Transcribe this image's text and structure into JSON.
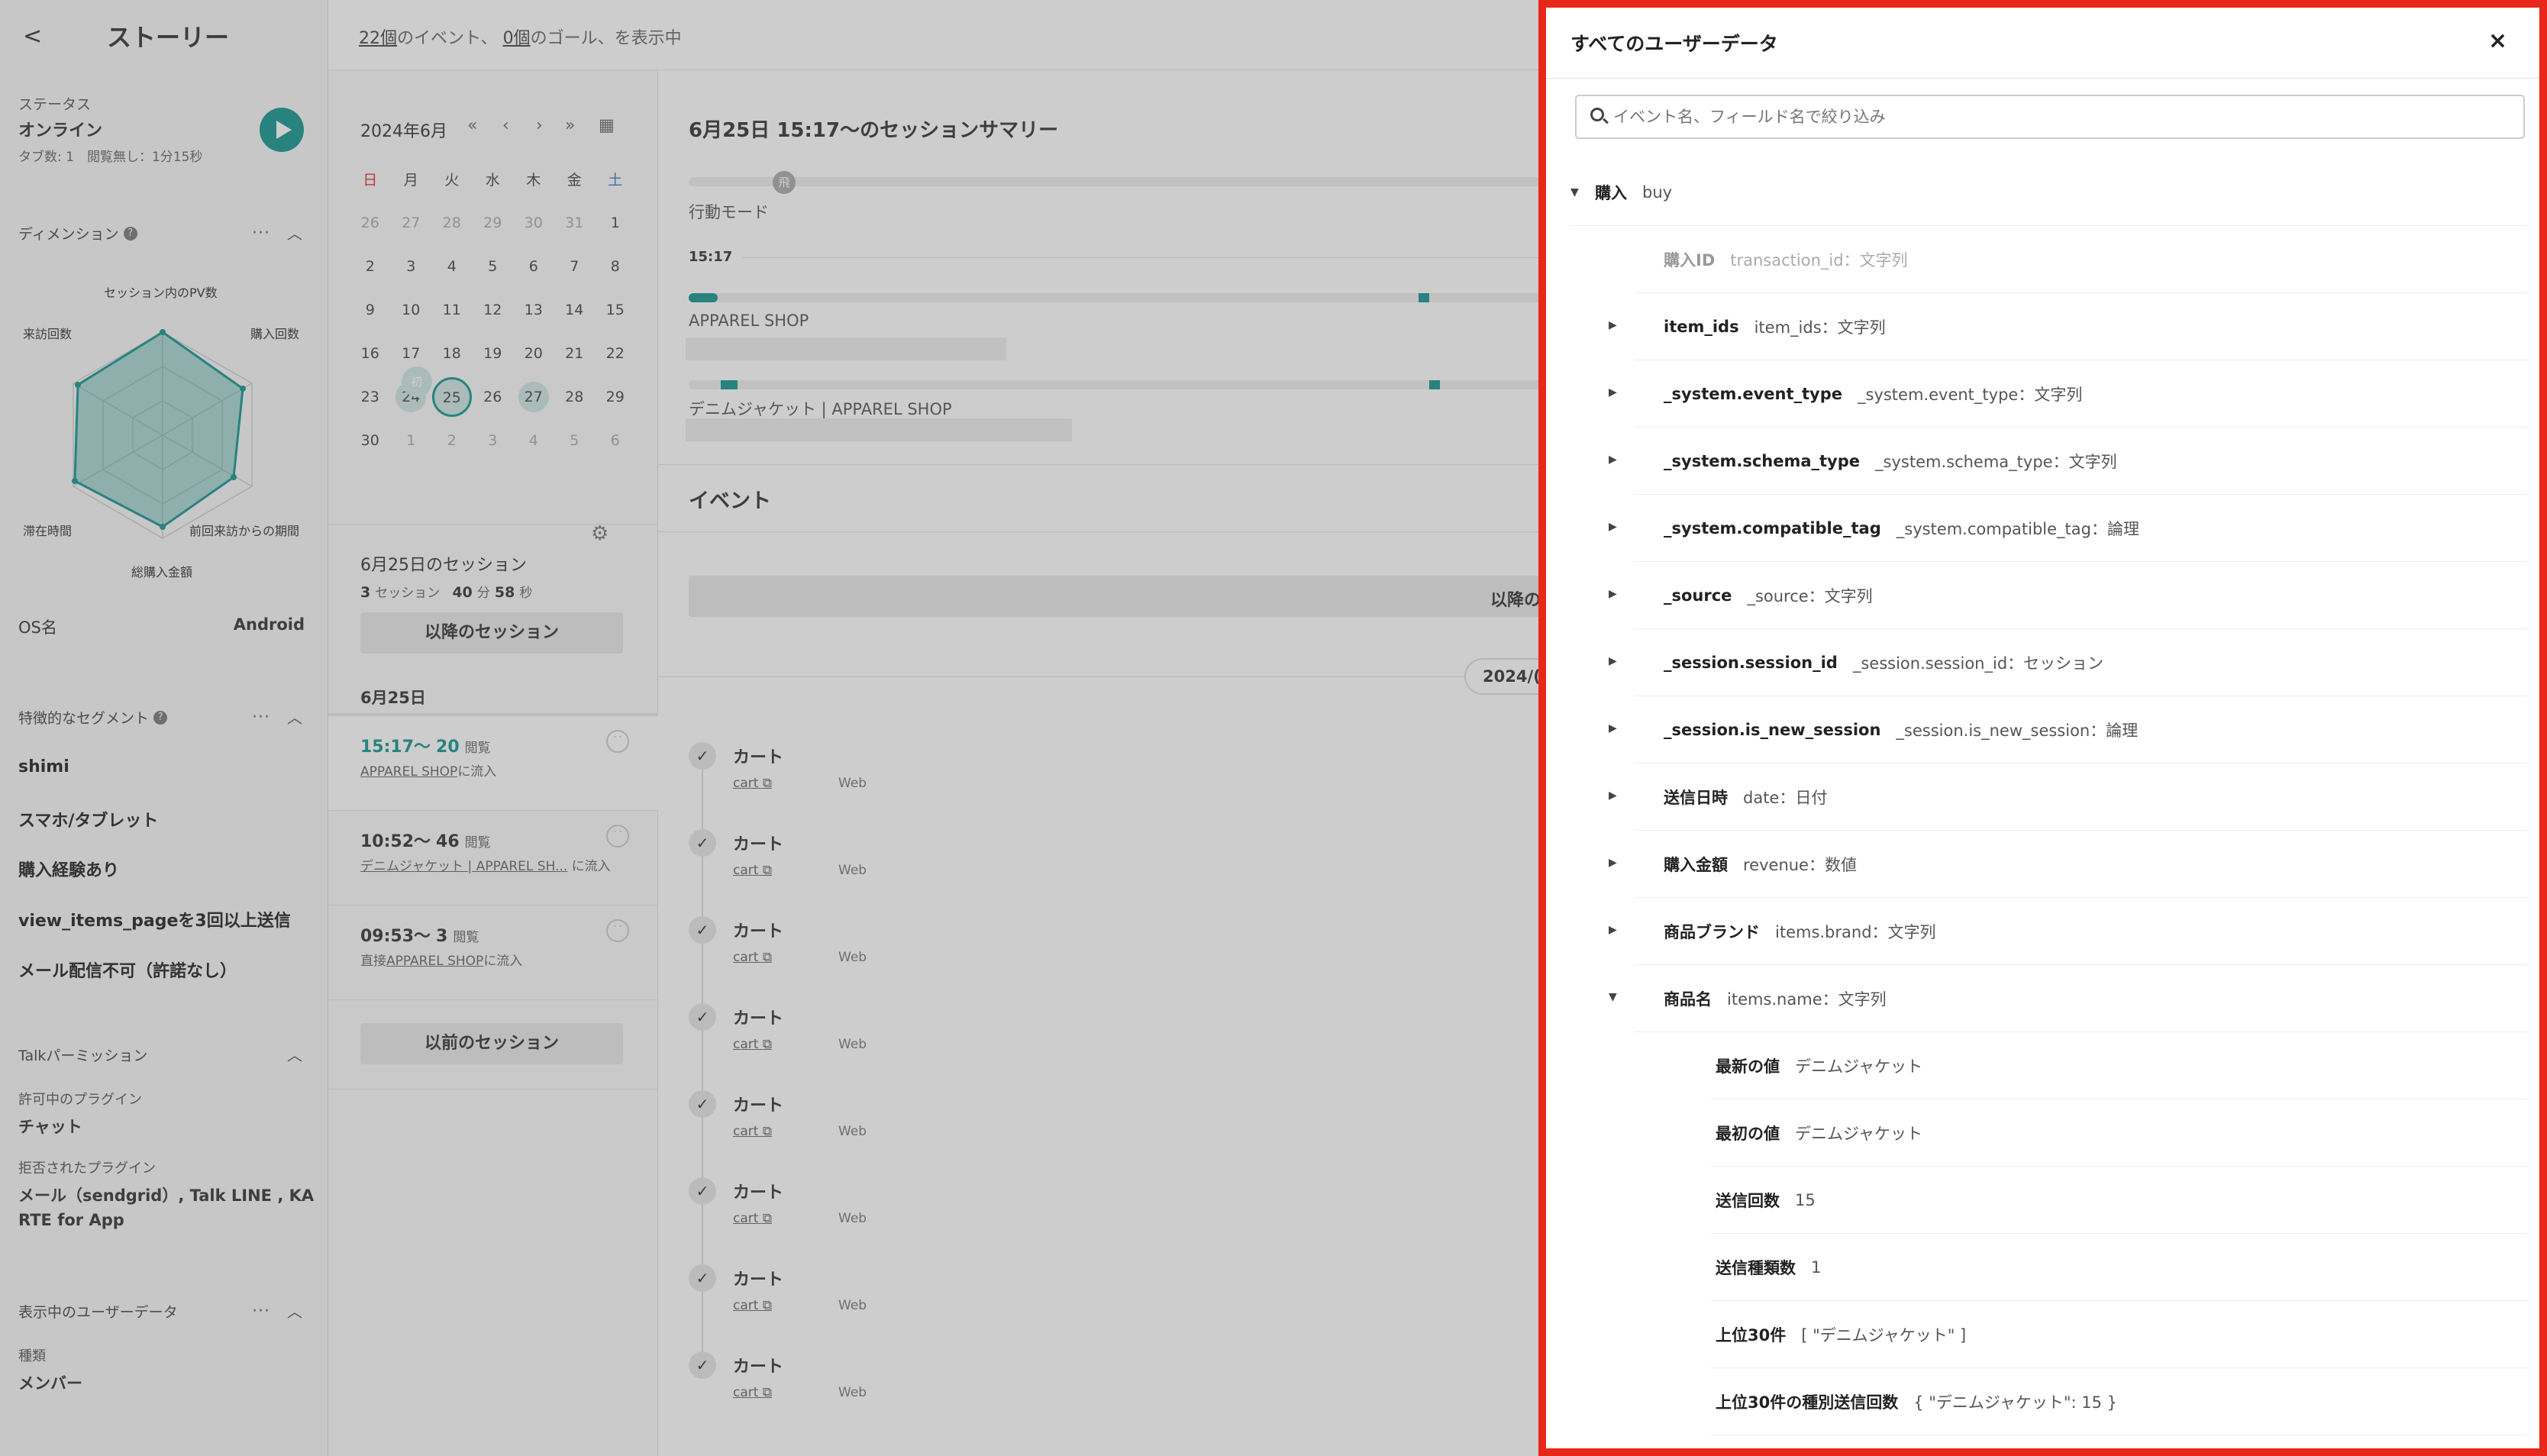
{
  "sidebar": {
    "back": "<",
    "title": "ストーリー",
    "status_label": "ステータス",
    "status_value": "オンライン",
    "status_sub": "タブ数: 1　閲覧無し：1分15秒",
    "dimension_label": "ディメンション",
    "radar_labels": [
      "セッション内のPV数",
      "購入回数",
      "前回来訪からの期間",
      "総購入金額",
      "滞在時間",
      "来訪回数"
    ],
    "os_label": "OS名",
    "os_value": "Android",
    "segment_label": "特徴的なセグメント",
    "segments": [
      "shimi",
      "スマホ/タブレット",
      "購入経験あり",
      "view_items_pageを3回以上送信",
      "メール配信不可（許諾なし）"
    ],
    "talk_label": "Talkパーミッション",
    "allowed_label": "許可中のプラグイン",
    "allowed_value": "チャット",
    "denied_label": "拒否されたプラグイン",
    "denied_value_1": "メール（sendgrid）, Talk LINE , KA",
    "denied_value_2": "RTE for App",
    "userdata_label": "表示中のユーザーデータ",
    "kind_label": "種類",
    "kind_value": "メンバー"
  },
  "topbar": {
    "events_count": "22個",
    "events_text": "のイベント、",
    "goals_count": "0個",
    "goals_text": "のゴール、を表示中"
  },
  "calendar": {
    "month": "2024年6月",
    "nav": [
      "«",
      "‹",
      "›",
      "»"
    ],
    "weekdays": [
      "日",
      "月",
      "火",
      "水",
      "木",
      "金",
      "土"
    ],
    "weeks": [
      [
        "26",
        "27",
        "28",
        "29",
        "30",
        "31",
        "1"
      ],
      [
        "2",
        "3",
        "4",
        "5",
        "6",
        "7",
        "8"
      ],
      [
        "9",
        "10",
        "11",
        "12",
        "13",
        "14",
        "15"
      ],
      [
        "16",
        "17",
        "18",
        "19",
        "20",
        "21",
        "22"
      ],
      [
        "23",
        "24",
        "25",
        "26",
        "27",
        "28",
        "29"
      ],
      [
        "30",
        "1",
        "2",
        "3",
        "4",
        "5",
        "6"
      ]
    ],
    "first_badge": "初",
    "sessions_title": "6月25日のセッション",
    "sessions_count": "3",
    "sessions_unit": "セッション",
    "minutes": "40",
    "minutes_unit": "分",
    "seconds": "58",
    "seconds_unit": "秒",
    "next_btn": "以降のセッション",
    "date_header": "6月25日",
    "prev_btn": "以前のセッション",
    "sessions": [
      {
        "time": "15:17〜",
        "count": "20",
        "unit": "閲覧",
        "link": "APPAREL SHOP",
        "suffix": "に流入"
      },
      {
        "time": "10:52〜",
        "count": "46",
        "unit": "閲覧",
        "link": "デニムジャケット | APPAREL SH...",
        "suffix": "に流入"
      },
      {
        "time": "09:53〜",
        "count": "3",
        "unit": "閲覧",
        "prefix": "直接",
        "link": "APPAREL SHOP",
        "suffix": "に流入"
      }
    ]
  },
  "main": {
    "summary_title": "6月25日 15:17〜のセッションサマリー",
    "mode_badge": "飛",
    "mode_label": "行動モード",
    "time_label": "15:17",
    "page1": "APPAREL SHOP",
    "page2": "デニムジャケット | APPAREL SHOP",
    "events_title": "イベント",
    "later_btn": "以降の",
    "date_chip": "2024/(",
    "events": [
      {
        "name": "カート",
        "link": "cart",
        "channel": "Web"
      },
      {
        "name": "カート",
        "link": "cart",
        "channel": "Web"
      },
      {
        "name": "カート",
        "link": "cart",
        "channel": "Web"
      },
      {
        "name": "カート",
        "link": "cart",
        "channel": "Web"
      },
      {
        "name": "カート",
        "link": "cart",
        "channel": "Web"
      },
      {
        "name": "カート",
        "link": "cart",
        "channel": "Web"
      },
      {
        "name": "カート",
        "link": "cart",
        "channel": "Web"
      },
      {
        "name": "カート",
        "link": "cart",
        "channel": "Web"
      }
    ]
  },
  "panel": {
    "title": "すべてのユーザーデータ",
    "close": "×",
    "search_placeholder": "イベント名、フィールド名で絞り込み",
    "root": {
      "key": "購入",
      "value": "buy"
    },
    "rows": [
      {
        "key": "購入ID",
        "value": "transaction_id：文字列",
        "faint": true,
        "expandable": false
      },
      {
        "key": "item_ids",
        "value": "item_ids：文字列",
        "expandable": true
      },
      {
        "key": "_system.event_type",
        "value": "_system.event_type：文字列",
        "expandable": true
      },
      {
        "key": "_system.schema_type",
        "value": "_system.schema_type：文字列",
        "expandable": true
      },
      {
        "key": "_system.compatible_tag",
        "value": "_system.compatible_tag：論理",
        "expandable": true
      },
      {
        "key": "_source",
        "value": "_source：文字列",
        "expandable": true
      },
      {
        "key": "_session.session_id",
        "value": "_session.session_id：セッション",
        "expandable": true
      },
      {
        "key": "_session.is_new_session",
        "value": "_session.is_new_session：論理",
        "expandable": true
      },
      {
        "key": "送信日時",
        "value": "date：日付",
        "expandable": true
      },
      {
        "key": "購入金額",
        "value": "revenue：数値",
        "expandable": true
      },
      {
        "key": "商品ブランド",
        "value": "items.brand：文字列",
        "expandable": true
      },
      {
        "key": "商品名",
        "value": "items.name：文字列",
        "expandable": true,
        "open": true
      }
    ],
    "details": [
      {
        "key": "最新の値",
        "value": "デニムジャケット"
      },
      {
        "key": "最初の値",
        "value": "デニムジャケット"
      },
      {
        "key": "送信回数",
        "value": "15"
      },
      {
        "key": "送信種類数",
        "value": "1"
      },
      {
        "key": "上位30件",
        "value": "[ \"デニムジャケット\" ]"
      },
      {
        "key": "上位30件の種別送信回数",
        "value": "{ \"デニムジャケット\": 15 }"
      }
    ]
  },
  "colors": {
    "accent": "#14958f",
    "highlight_border": "#e8261a"
  }
}
